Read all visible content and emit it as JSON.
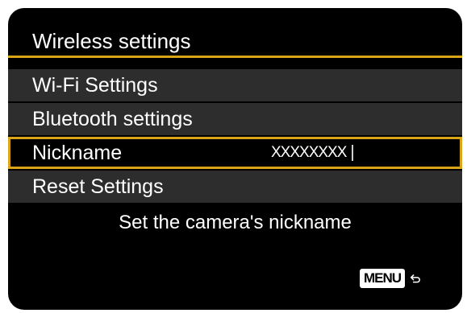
{
  "header": {
    "title": "Wireless settings"
  },
  "menu": {
    "items": [
      {
        "label": "Wi-Fi Settings",
        "value": ""
      },
      {
        "label": "Bluetooth settings",
        "value": ""
      },
      {
        "label": "Nickname",
        "value": "XXXXXXXX",
        "selected": true
      },
      {
        "label": "Reset Settings",
        "value": ""
      }
    ]
  },
  "help_text": "Set the camera's nickname",
  "footer": {
    "menu_label": "MENU",
    "return_icon": "return-arrow-icon"
  },
  "colors": {
    "accent": "#d9a517",
    "item_background": "#2d2d2d",
    "screen_background": "#000000"
  }
}
